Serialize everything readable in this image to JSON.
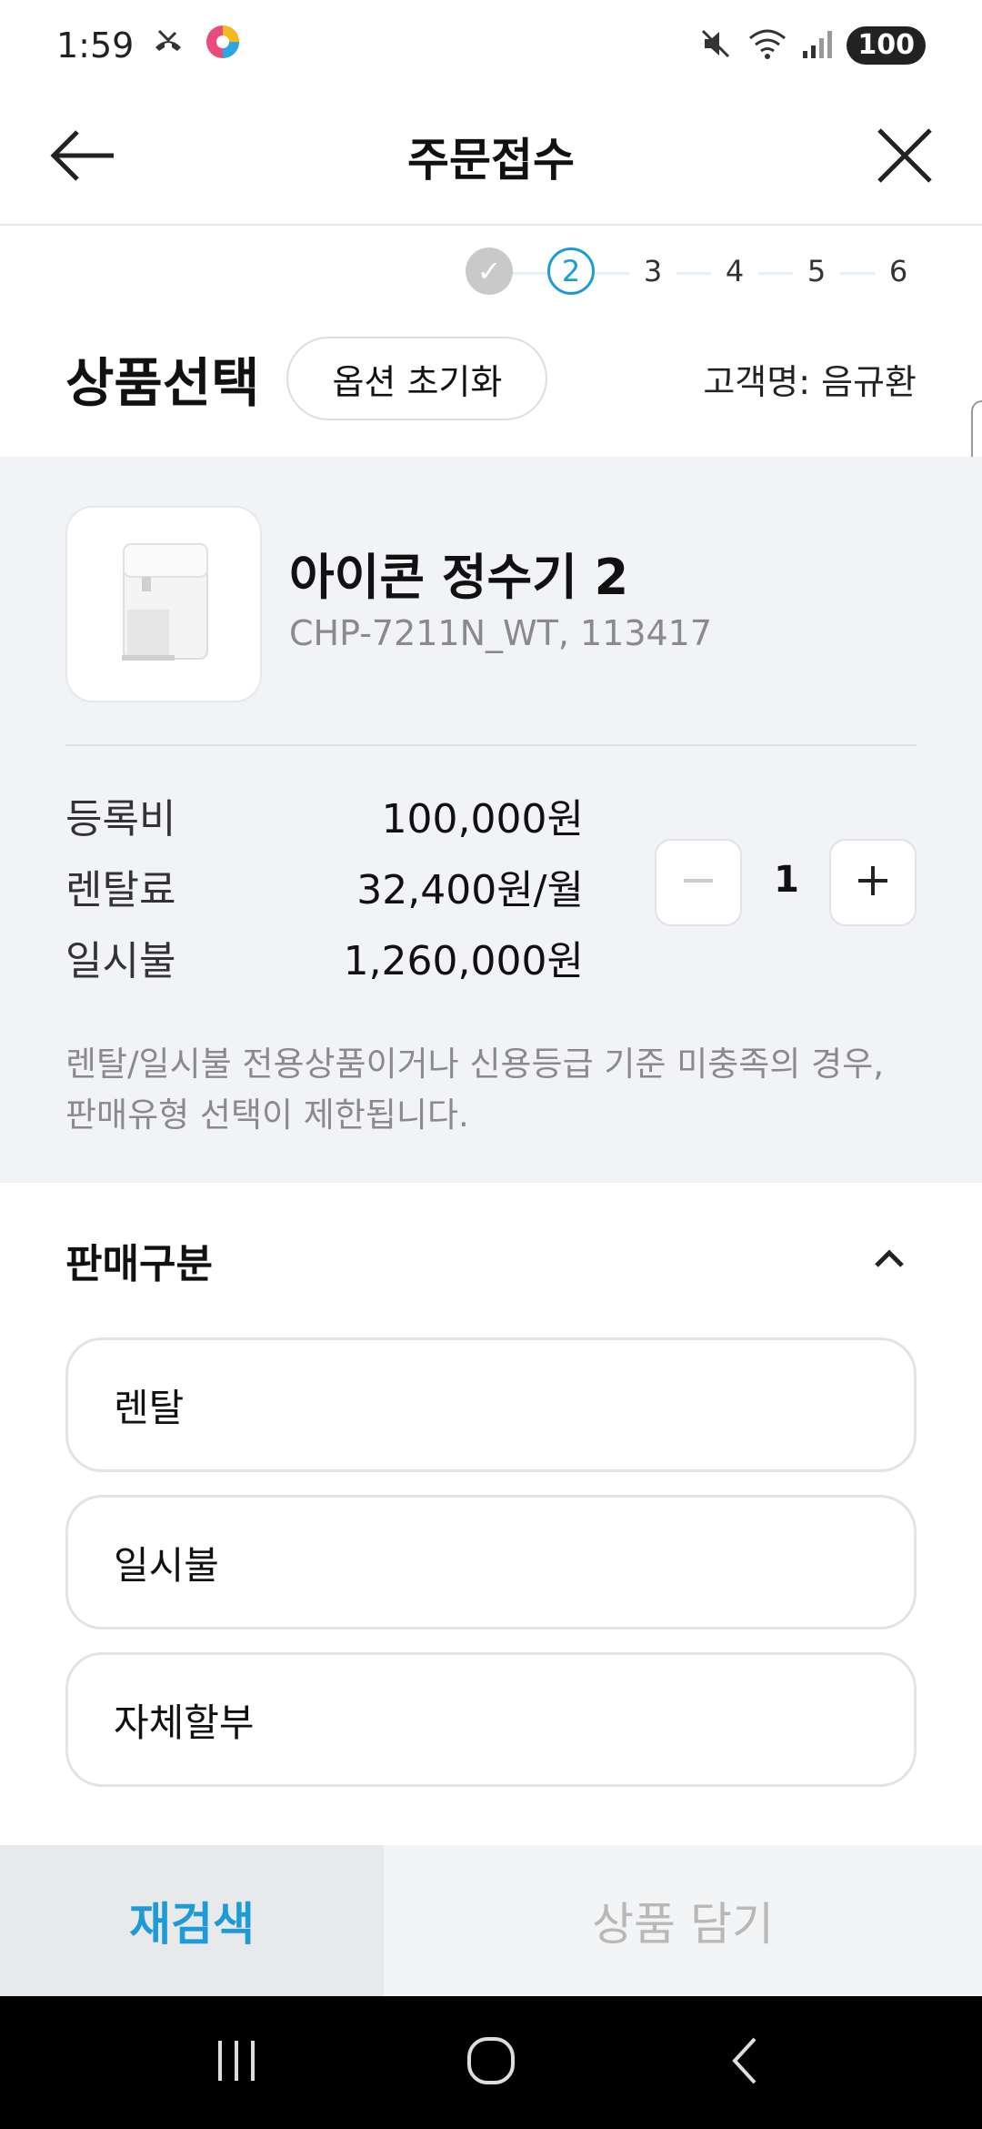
{
  "status_bar": {
    "time": "1:59",
    "battery": "100"
  },
  "header": {
    "title": "주문접수"
  },
  "steps": [
    {
      "label": "✓",
      "state": "done"
    },
    {
      "label": "2",
      "state": "active"
    },
    {
      "label": "3",
      "state": "pending"
    },
    {
      "label": "4",
      "state": "pending"
    },
    {
      "label": "5",
      "state": "pending"
    },
    {
      "label": "6",
      "state": "pending"
    }
  ],
  "section": {
    "title": "상품선택",
    "reset_label": "옵션 초기화",
    "customer": "고객명: 음규환"
  },
  "product": {
    "name": "아이콘 정수기 2",
    "code": "CHP-7211N_WT, 113417",
    "prices": [
      {
        "label": "등록비",
        "value": "100,000원"
      },
      {
        "label": "렌탈료",
        "value": "32,400원/월"
      },
      {
        "label": "일시불",
        "value": "1,260,000원"
      }
    ],
    "quantity": "1",
    "notice_line1": "렌탈/일시불 전용상품이거나 신용등급 기준 미충족의 경우,",
    "notice_line2": "판매유형 선택이 제한됩니다."
  },
  "sale_type": {
    "title": "판매구분",
    "options": [
      "렌탈",
      "일시불",
      "자체할부"
    ]
  },
  "bottom": {
    "research_label": "재검색",
    "add_cart_label": "상품 담기"
  },
  "colors": {
    "accent": "#1e9bd7",
    "panel_bg": "#f1f3f7"
  }
}
